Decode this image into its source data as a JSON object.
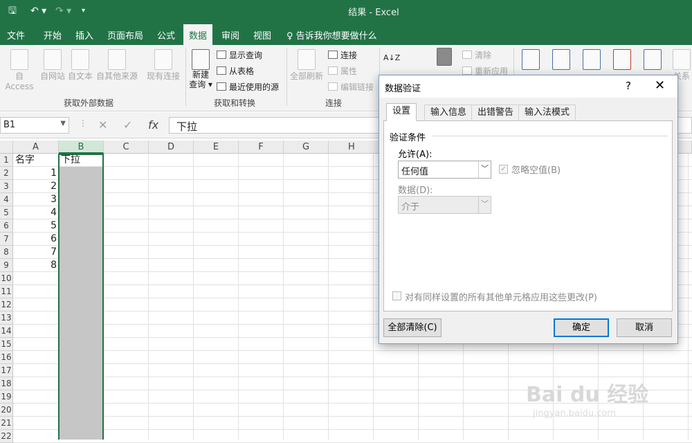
{
  "window": {
    "title": "结果 - Excel",
    "qat_save": "🖫",
    "qat_undo": "↶ ▾",
    "qat_redo": "↷ ▾",
    "qat_more": "▾"
  },
  "tabs": [
    "文件",
    "开始",
    "插入",
    "页面布局",
    "公式",
    "数据",
    "审阅",
    "视图"
  ],
  "active_tab": "数据",
  "tell_me": "♀ 告诉我你想要做什么",
  "ribbon": {
    "get_external": {
      "items": [
        "自 Access",
        "自网站",
        "自文本",
        "自其他来源",
        "现有连接"
      ],
      "group": "获取外部数据"
    },
    "transform": {
      "new_query": "新建\n查询 ▾",
      "show_query": "显示查询",
      "from_table": "从表格",
      "recent": "最近使用的源",
      "group": "获取和转换"
    },
    "connections": {
      "refresh_all": "全部刷新",
      "connect": "连接",
      "properties": "属性",
      "edit_links": "编辑链接",
      "group": "连接"
    },
    "sort_filter": {
      "clear": "清除",
      "reapply": "重新应用",
      "sort_az": "A↓Z",
      "filter_icon": "funnel-icon"
    },
    "right_partial": "关系"
  },
  "formula_bar": {
    "name_box": "B1",
    "cancel": "✕",
    "enter": "✓",
    "fx": "fx",
    "content": "下拉"
  },
  "columns": [
    "A",
    "B",
    "C",
    "D",
    "E",
    "F",
    "G",
    "H"
  ],
  "rows": [
    "1",
    "2",
    "3",
    "4",
    "5",
    "6",
    "7",
    "8",
    "9",
    "10",
    "11",
    "12",
    "13",
    "14",
    "15",
    "16",
    "17",
    "18",
    "19",
    "20",
    "21",
    "22"
  ],
  "cells": {
    "A1": "名字",
    "B1": "下拉",
    "A_values": [
      "1",
      "2",
      "3",
      "4",
      "5",
      "6",
      "7",
      "8"
    ]
  },
  "dialog": {
    "title": "数据验证",
    "help": "?",
    "close": "✕",
    "tabs": [
      "设置",
      "输入信息",
      "出错警告",
      "输入法模式"
    ],
    "section": "验证条件",
    "allow_label": "允许(A):",
    "allow_value": "任何值",
    "ignore_blank": "忽略空值(B)",
    "data_label": "数据(D):",
    "data_value": "介于",
    "apply_all": "对有同样设置的所有其他单元格应用这些更改(P)",
    "clear_all": "全部清除(C)",
    "ok": "确定",
    "cancel": "取消"
  },
  "watermark": {
    "brand": "Bai du 经验",
    "url": "jingyan.baidu.com"
  }
}
